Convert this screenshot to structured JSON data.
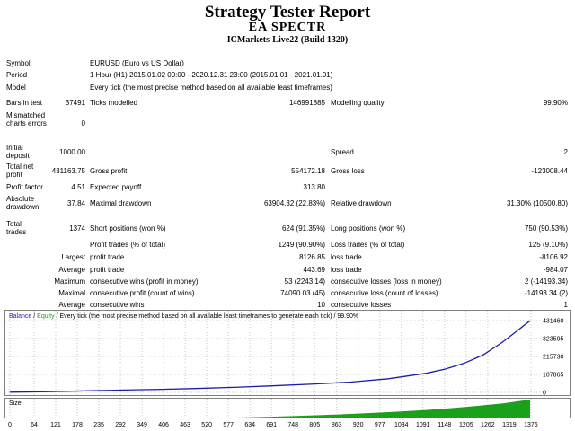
{
  "header": {
    "title": "Strategy Tester Report",
    "ea_name": "EA SPECTR",
    "server": "ICMarkets-Live22 (Build 1320)"
  },
  "info": {
    "symbol_label": "Symbol",
    "symbol_value": "EURUSD (Euro vs US Dollar)",
    "period_label": "Period",
    "period_value": "1 Hour (H1) 2015.01.02 00:00 - 2020.12.31 23:00 (2015.01.01 - 2021.01.01)",
    "model_label": "Model",
    "model_value": "Every tick (the most precise method based on all available least timeframes)"
  },
  "stats": {
    "bars_label": "Bars in test",
    "bars_value": "37491",
    "ticks_label": "Ticks modelled",
    "ticks_value": "146991885",
    "quality_label": "Modelling quality",
    "quality_value": "99.90%",
    "mismatch_label": "Mismatched charts errors",
    "mismatch_value": "0",
    "deposit_label": "Initial deposit",
    "deposit_value": "1000.00",
    "spread_label": "Spread",
    "spread_value": "2",
    "netprofit_label": "Total net profit",
    "netprofit_value": "431163.75",
    "grossprofit_label": "Gross profit",
    "grossprofit_value": "554172.18",
    "grossloss_label": "Gross loss",
    "grossloss_value": "-123008.44",
    "pf_label": "Profit factor",
    "pf_value": "4.51",
    "payoff_label": "Expected payoff",
    "payoff_value": "313.80",
    "absdd_label": "Absolute drawdown",
    "absdd_value": "37.84",
    "maxdd_label": "Maximal drawdown",
    "maxdd_value": "63904.32 (22.83%)",
    "reldd_label": "Relative drawdown",
    "reldd_value": "31.30% (10500.80)",
    "trades_label": "Total trades",
    "trades_value": "1374",
    "short_label": "Short positions (won %)",
    "short_value": "624 (91.35%)",
    "long_label": "Long positions (won %)",
    "long_value": "750 (90.53%)",
    "ptrades_label": "Profit trades (% of total)",
    "ptrades_value": "1249 (90.90%)",
    "ltrades_label": "Loss trades (% of total)",
    "ltrades_value": "125 (9.10%)",
    "largest_label": "Largest",
    "largest_profit_label": "profit trade",
    "largest_profit_value": "8126.85",
    "largest_loss_label": "loss trade",
    "largest_loss_value": "-8106.92",
    "average_label": "Average",
    "average_profit_label": "profit trade",
    "average_profit_value": "443.69",
    "average_loss_label": "loss trade",
    "average_loss_value": "-984.07",
    "maximum_label": "Maximum",
    "max_wins_label": "consecutive wins (profit in money)",
    "max_wins_value": "53 (2243.14)",
    "max_losses_label": "consecutive losses (loss in money)",
    "max_losses_value": "2 (-14193.34)",
    "maximal_label": "Maximal",
    "maximal_profit_label": "consecutive profit (count of wins)",
    "maximal_profit_value": "74090.03 (45)",
    "maximal_loss_label": "consecutive loss (count of losses)",
    "maximal_loss_value": "-14193.34 (2)",
    "avg2_label": "Average",
    "avg_wins_label": "consecutive wins",
    "avg_wins_value": "10",
    "avg_losses_label": "consecutive losses",
    "avg_losses_value": "1"
  },
  "chart_data": {
    "type": "line",
    "legend": {
      "balance": "Balance",
      "sep": "/",
      "equity": "Equity",
      "desc": "/ Every tick (the most precise method based on all available least timeframes to generate each tick) / 99.90%"
    },
    "series_colors": {
      "balance": "#1c1ca8",
      "equity": "#1aa01a",
      "size": "#1aa01a"
    },
    "size_label": "Size",
    "ylim": [
      0,
      431460
    ],
    "yticks": [
      431460,
      323595,
      215730,
      107865,
      0
    ],
    "xlim": [
      0,
      1400
    ],
    "xticks": [
      0,
      64,
      121,
      178,
      235,
      292,
      349,
      406,
      463,
      520,
      577,
      634,
      691,
      748,
      805,
      863,
      920,
      977,
      1034,
      1091,
      1148,
      1205,
      1262,
      1319,
      1376
    ],
    "balance_x": [
      0,
      100,
      200,
      300,
      400,
      500,
      600,
      700,
      800,
      900,
      1000,
      1100,
      1150,
      1200,
      1250,
      1300,
      1340,
      1374
    ],
    "balance_y": [
      1000,
      4000,
      9000,
      14000,
      18000,
      24000,
      31000,
      40000,
      50000,
      62000,
      82000,
      115000,
      140000,
      175000,
      225000,
      300000,
      370000,
      431164
    ],
    "size_x": [
      0,
      600,
      700,
      800,
      900,
      1000,
      1100,
      1200,
      1300,
      1374
    ],
    "size_y": [
      0,
      0,
      5,
      12,
      20,
      30,
      42,
      58,
      78,
      100
    ]
  }
}
